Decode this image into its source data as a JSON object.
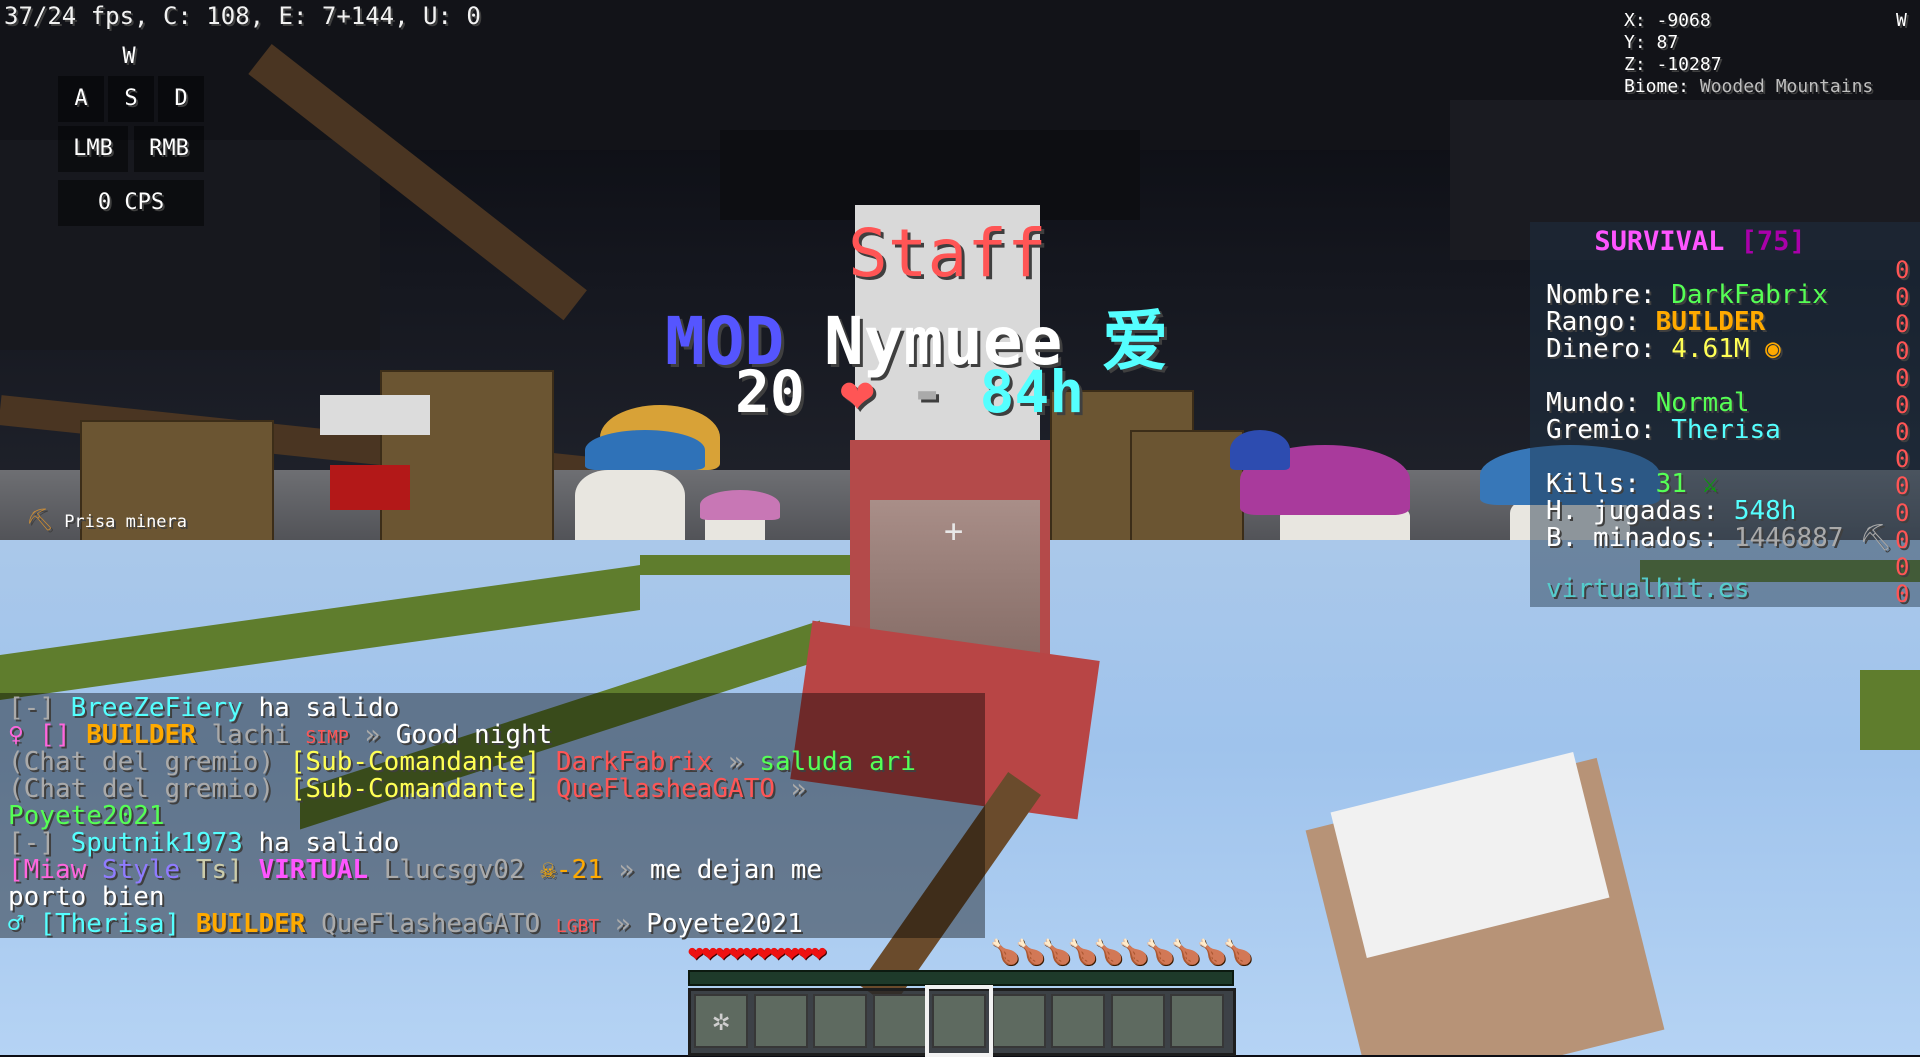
{
  "debug": {
    "fps": "37/24 fps, C: 108, E: 7+144, U: 0"
  },
  "keystrokes": {
    "w": "W",
    "a": "A",
    "s": "S",
    "d": "D",
    "lmb": "LMB",
    "rmb": "RMB",
    "cps": "0 CPS"
  },
  "coords": {
    "x": "X: -9068",
    "y": "Y: 87",
    "z": "Z: -10287",
    "biome_label": "Biome: ",
    "biome": "Wooded Mountains",
    "compass": "W"
  },
  "nametag": {
    "staff": "Staff",
    "rank": "MOD",
    "name": "Nymuee",
    "glyph": "爱",
    "left_value": "20",
    "heart": "❤",
    "dash": "-",
    "right_value": "84h"
  },
  "tool": {
    "label": "Prisa minera"
  },
  "scoreboard": {
    "title": "SURVIVAL",
    "title_count": "[75]",
    "nombre_label": "Nombre: ",
    "nombre": "DarkFabrix",
    "rango_label": "Rango: ",
    "rango": "BUILDER",
    "dinero_label": "Dinero: ",
    "dinero": "4.61M",
    "mundo_label": "Mundo: ",
    "mundo": "Normal",
    "gremio_label": "Gremio: ",
    "gremio": "Therisa",
    "kills_label": "Kills: ",
    "kills": "31",
    "horas_label": "H. jugadas: ",
    "horas": "548h",
    "minados_label": "B. minados: ",
    "minados": "1446887",
    "footer": "virtualhit.es",
    "score_digit": "0"
  },
  "chat": {
    "l1_prefix": "[-] ",
    "l1_name": "BreeZeFiery",
    "l1_text": " ha salido",
    "l2_icon": "♀ [] ",
    "l2_rank": "BUILDER",
    "l2_name": " lachi ",
    "l2_tag": "SIMP",
    "l2_sep": " » ",
    "l2_text": "Good night",
    "l3_chan": "(Chat del gremio) ",
    "l3_role": "[Sub-Comandante]",
    "l3_name": " DarkFabrix",
    "l3_sep": " » ",
    "l3_text": "saluda ari",
    "l4_chan": "(Chat del gremio) ",
    "l4_role": "[Sub-Comandante]",
    "l4_name": " QueFlasheaGATO",
    "l4_sep": " »",
    "l5_text": " Poyete2021",
    "l6_prefix": "[-] ",
    "l6_name": "Sputnik1973",
    "l6_text": " ha salido",
    "l7_a": "[Miaw",
    "l7_b": " Style",
    "l7_c": " Ts]",
    "l7_rank": " VIRTUAL",
    "l7_name": " Llucsgv02 ",
    "l7_skull": "☠-21",
    "l7_sep": " » ",
    "l7_text": "me dejan me",
    "l8_text": " porto bien",
    "l9_icon": "♂ ",
    "l9_guild": "[Therisa]",
    "l9_rank": " BUILDER",
    "l9_name": " QueFlasheaGATO ",
    "l9_tag": "LGBT",
    "l9_sep": " » ",
    "l9_text": "Poyete2021"
  },
  "hud": {
    "hearts": "❤❤❤❤❤❤❤❤❤❤",
    "food": "🍗🍗🍗🍗🍗🍗🍗🍗🍗🍗",
    "crosshair": "+",
    "selected_slot": 5
  },
  "colors": {
    "staff": "#ff5555",
    "mod": "#5555ff",
    "survival": "#ff55ff",
    "builder": "#ffaa00"
  }
}
